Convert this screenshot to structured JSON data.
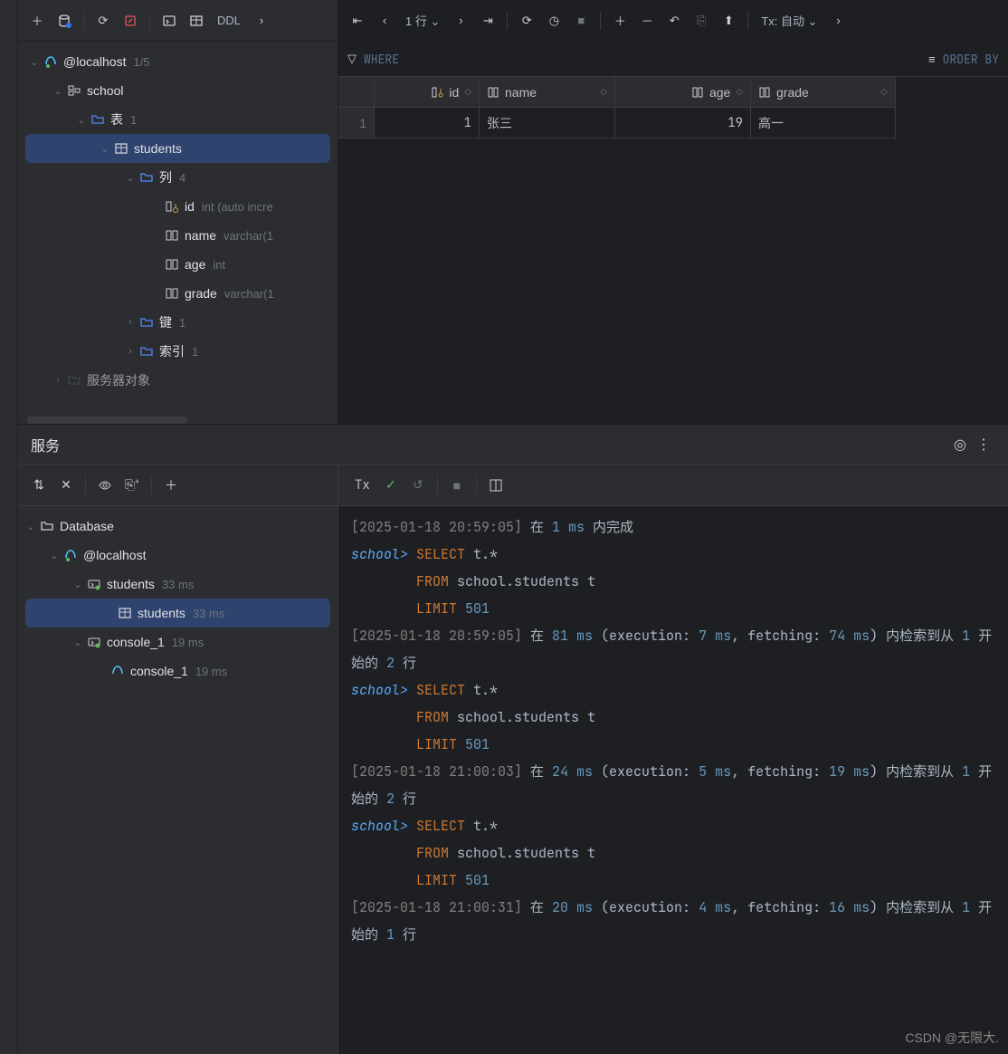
{
  "db_toolbar": {
    "ddl": "DDL"
  },
  "tree": {
    "conn": "@localhost",
    "conn_meta": "1/5",
    "schema": "school",
    "tables": "表",
    "tables_meta": "1",
    "table": "students",
    "cols": "列",
    "cols_meta": "4",
    "col_id": "id",
    "col_id_meta": "int (auto incre",
    "col_name": "name",
    "col_name_meta": "varchar(1",
    "col_age": "age",
    "col_age_meta": "int",
    "col_grade": "grade",
    "col_grade_meta": "varchar(1",
    "keys": "键",
    "keys_meta": "1",
    "idx": "索引",
    "idx_meta": "1",
    "srvobj": "服务器对象"
  },
  "data_toolbar": {
    "rows": "1 行",
    "tx": "Tx: 自动"
  },
  "filter": {
    "where": "WHERE",
    "order": "ORDER BY"
  },
  "grid": {
    "headers": {
      "id": "id",
      "name": "name",
      "age": "age",
      "grade": "grade"
    },
    "row_num": "1",
    "row": {
      "id": "1",
      "name": "张三",
      "age": "19",
      "grade": "高一"
    }
  },
  "services": {
    "title": "服务",
    "tree": {
      "root": "Database",
      "conn": "@localhost",
      "group1": "students",
      "group1_meta": "33 ms",
      "item1": "students",
      "item1_meta": "33 ms",
      "group2": "console_1",
      "group2_meta": "19 ms",
      "item2": "console_1",
      "item2_meta": "19 ms"
    },
    "tx_label": "Tx"
  },
  "console_lines": [
    {
      "t": "ts",
      "v": "[2025-01-18 20:59:05] "
    },
    {
      "t": "tx",
      "v": "在 "
    },
    {
      "t": "num",
      "v": "1 ms"
    },
    {
      "t": "tx",
      "v": " 内完成"
    },
    {
      "t": "br"
    },
    {
      "t": "pr",
      "v": "school> "
    },
    {
      "t": "kw",
      "v": "SELECT "
    },
    {
      "t": "tx",
      "v": "t.*"
    },
    {
      "t": "br"
    },
    {
      "t": "sp",
      "v": "        "
    },
    {
      "t": "kw",
      "v": "FROM "
    },
    {
      "t": "tx",
      "v": "school.students t"
    },
    {
      "t": "br"
    },
    {
      "t": "sp",
      "v": "        "
    },
    {
      "t": "kw",
      "v": "LIMIT "
    },
    {
      "t": "num",
      "v": "501"
    },
    {
      "t": "br"
    },
    {
      "t": "ts",
      "v": "[2025-01-18 20:59:05] "
    },
    {
      "t": "tx",
      "v": "在 "
    },
    {
      "t": "num",
      "v": "81 ms"
    },
    {
      "t": "tx",
      "v": " (execution: "
    },
    {
      "t": "num",
      "v": "7 ms"
    },
    {
      "t": "tx",
      "v": ", fetching: "
    },
    {
      "t": "num",
      "v": "74 ms"
    },
    {
      "t": "tx",
      "v": ") 内检索到从 "
    },
    {
      "t": "num",
      "v": "1"
    },
    {
      "t": "tx",
      "v": " 开始的 "
    },
    {
      "t": "num",
      "v": "2"
    },
    {
      "t": "tx",
      "v": " 行"
    },
    {
      "t": "br"
    },
    {
      "t": "pr",
      "v": "school> "
    },
    {
      "t": "kw",
      "v": "SELECT "
    },
    {
      "t": "tx",
      "v": "t.*"
    },
    {
      "t": "br"
    },
    {
      "t": "sp",
      "v": "        "
    },
    {
      "t": "kw",
      "v": "FROM "
    },
    {
      "t": "tx",
      "v": "school.students t"
    },
    {
      "t": "br"
    },
    {
      "t": "sp",
      "v": "        "
    },
    {
      "t": "kw",
      "v": "LIMIT "
    },
    {
      "t": "num",
      "v": "501"
    },
    {
      "t": "br"
    },
    {
      "t": "ts",
      "v": "[2025-01-18 21:00:03] "
    },
    {
      "t": "tx",
      "v": "在 "
    },
    {
      "t": "num",
      "v": "24 ms"
    },
    {
      "t": "tx",
      "v": " (execution: "
    },
    {
      "t": "num",
      "v": "5 ms"
    },
    {
      "t": "tx",
      "v": ", fetching: "
    },
    {
      "t": "num",
      "v": "19 ms"
    },
    {
      "t": "tx",
      "v": ") 内检索到从 "
    },
    {
      "t": "num",
      "v": "1"
    },
    {
      "t": "tx",
      "v": " 开始的 "
    },
    {
      "t": "num",
      "v": "2"
    },
    {
      "t": "tx",
      "v": " 行"
    },
    {
      "t": "br"
    },
    {
      "t": "pr",
      "v": "school> "
    },
    {
      "t": "kw",
      "v": "SELECT "
    },
    {
      "t": "tx",
      "v": "t.*"
    },
    {
      "t": "br"
    },
    {
      "t": "sp",
      "v": "        "
    },
    {
      "t": "kw",
      "v": "FROM "
    },
    {
      "t": "tx",
      "v": "school.students t"
    },
    {
      "t": "br"
    },
    {
      "t": "sp",
      "v": "        "
    },
    {
      "t": "kw",
      "v": "LIMIT "
    },
    {
      "t": "num",
      "v": "501"
    },
    {
      "t": "br"
    },
    {
      "t": "ts",
      "v": "[2025-01-18 21:00:31] "
    },
    {
      "t": "tx",
      "v": "在 "
    },
    {
      "t": "num",
      "v": "20 ms"
    },
    {
      "t": "tx",
      "v": " (execution: "
    },
    {
      "t": "num",
      "v": "4 ms"
    },
    {
      "t": "tx",
      "v": ", fetching: "
    },
    {
      "t": "num",
      "v": "16 ms"
    },
    {
      "t": "tx",
      "v": ") 内检索到从 "
    },
    {
      "t": "num",
      "v": "1"
    },
    {
      "t": "tx",
      "v": " 开始的 "
    },
    {
      "t": "num",
      "v": "1"
    },
    {
      "t": "tx",
      "v": " 行"
    }
  ],
  "watermark": "CSDN @无限大."
}
